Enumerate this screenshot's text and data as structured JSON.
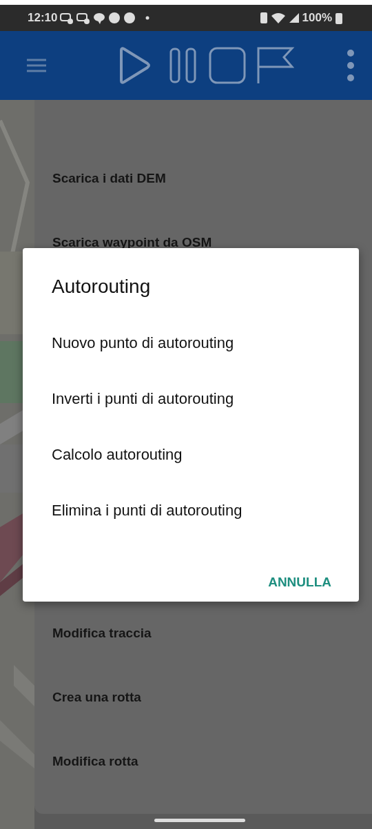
{
  "status_bar": {
    "time": "12:10",
    "battery": "100%"
  },
  "menu": {
    "items": [
      {
        "label": "Scarica i dati DEM"
      },
      {
        "label": "Scarica waypoint da OSM"
      },
      {
        "label": "Modifica traccia"
      },
      {
        "label": "Crea una rotta"
      },
      {
        "label": "Modifica rotta"
      }
    ]
  },
  "dialog": {
    "title": "Autorouting",
    "options": [
      {
        "label": "Nuovo punto di autorouting"
      },
      {
        "label": "Inverti i punti di autorouting"
      },
      {
        "label": "Calcolo autorouting"
      },
      {
        "label": "Elimina i punti di autorouting"
      }
    ],
    "cancel": "ANNULLA"
  }
}
